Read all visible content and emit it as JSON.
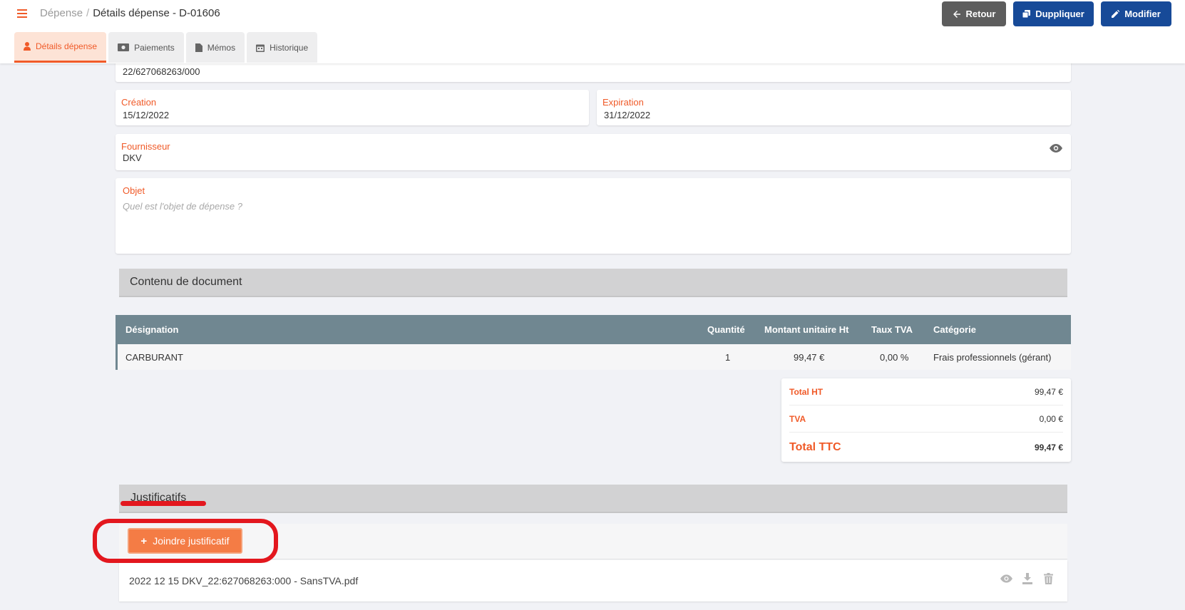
{
  "breadcrumb": {
    "parent": "Dépense",
    "separator": "/",
    "current": "Détails dépense - D-01606"
  },
  "header_buttons": {
    "retour": "Retour",
    "dupliquer": "Duppliquer",
    "modifier": "Modifier"
  },
  "tabs": [
    {
      "label": "Détails dépense",
      "icon": "person-icon",
      "active": true
    },
    {
      "label": "Paiements",
      "icon": "money-icon",
      "active": false
    },
    {
      "label": "Mémos",
      "icon": "document-icon",
      "active": false
    },
    {
      "label": "Historique",
      "icon": "calendar-icon",
      "active": false
    }
  ],
  "fields": {
    "reference_value": "22/627068263/000",
    "creation": {
      "label": "Création",
      "value": "15/12/2022"
    },
    "expiration": {
      "label": "Expiration",
      "value": "31/12/2022"
    },
    "fournisseur": {
      "label": "Fournisseur",
      "value": "DKV"
    },
    "objet": {
      "label": "Objet",
      "placeholder": "Quel est l'objet de dépense ?"
    }
  },
  "content_section": {
    "title": "Contenu de document",
    "columns": [
      "Désignation",
      "Quantité",
      "Montant unitaire Ht",
      "Taux TVA",
      "Catégorie"
    ],
    "rows": [
      {
        "designation": "CARBURANT",
        "quantite": "1",
        "montant": "99,47 €",
        "taux": "0,00 %",
        "categorie": "Frais professionnels (gérant)"
      }
    ]
  },
  "totals": {
    "ht": {
      "label": "Total HT",
      "value": "99,47 €"
    },
    "tva": {
      "label": "TVA",
      "value": "0,00 €"
    },
    "ttc": {
      "label": "Total TTC",
      "value": "99,47 €"
    }
  },
  "justificatifs": {
    "title": "Justificatifs",
    "add_button": "Joindre justificatif",
    "files": [
      {
        "name": "2022 12 15 DKV_22:627068263:000 - SansTVA.pdf"
      }
    ]
  },
  "colors": {
    "accent": "#f05a28",
    "primary": "#174a98",
    "table_header": "#708791",
    "annotation": "#e3171e"
  }
}
